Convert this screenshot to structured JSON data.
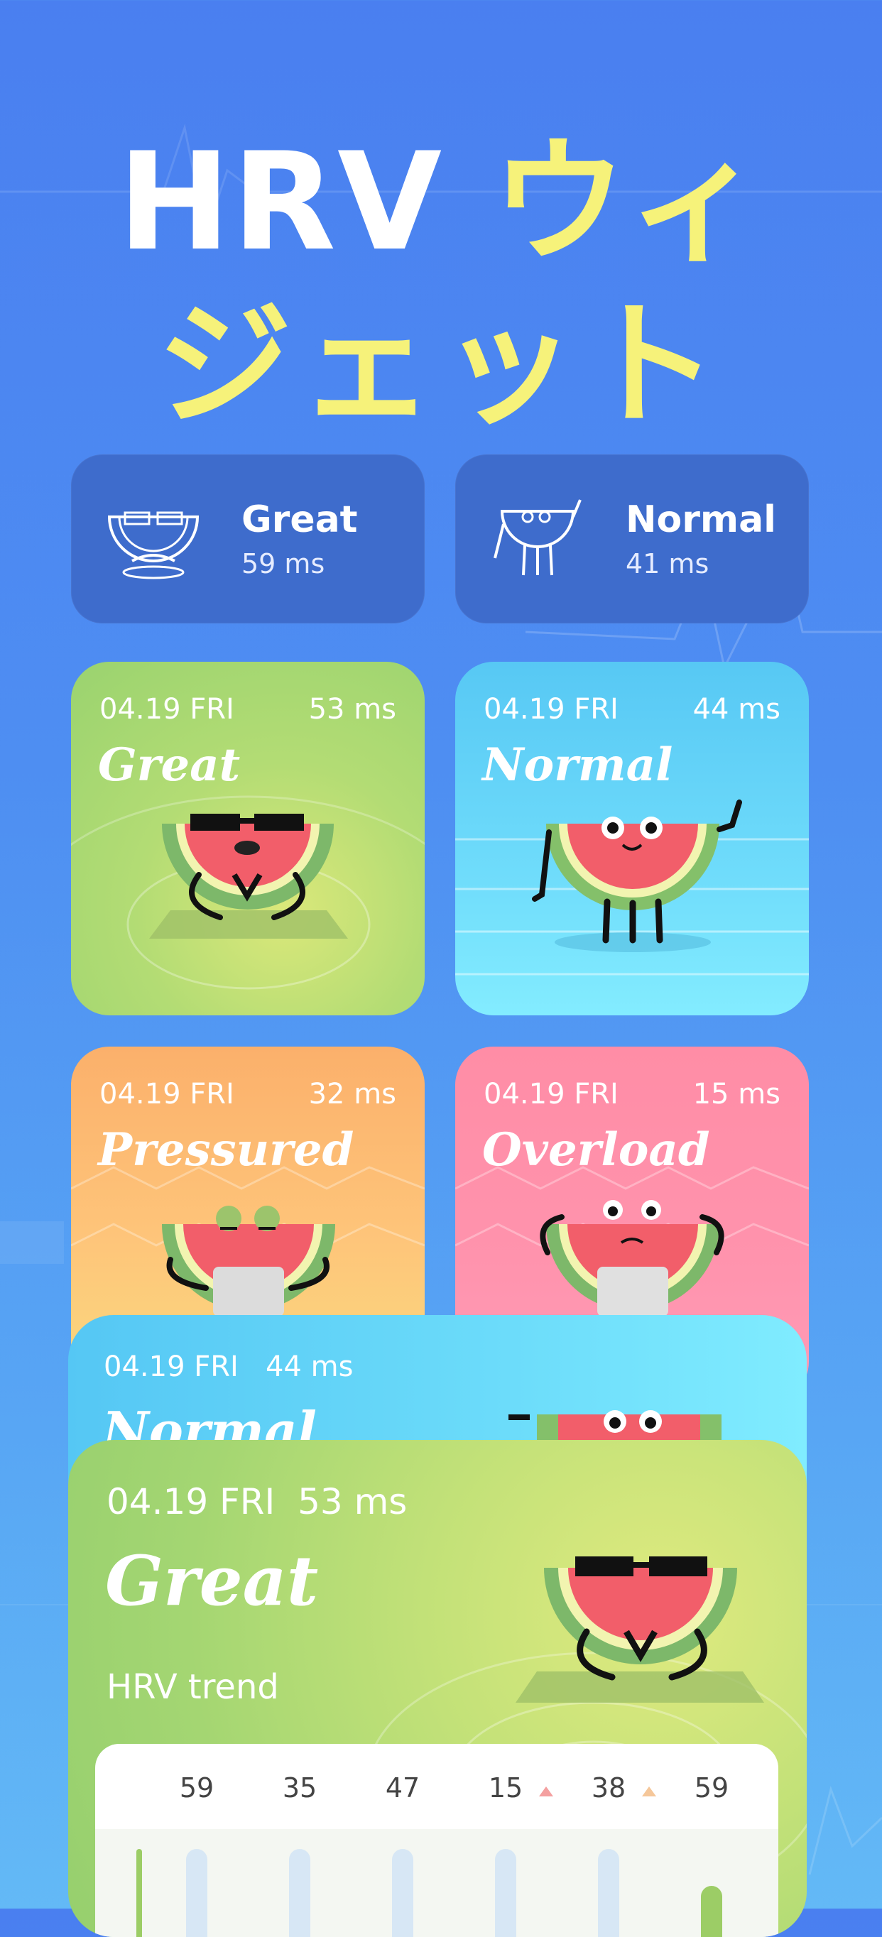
{
  "title": {
    "line1_white": "HRV ",
    "line1_yellow": "ウィ",
    "line2": "ジェット"
  },
  "small_widgets": [
    {
      "status": "Great",
      "value": "59 ms",
      "icon": "sunglasses-watermelon-icon"
    },
    {
      "status": "Normal",
      "value": "41 ms",
      "icon": "waving-watermelon-icon"
    }
  ],
  "tiles": [
    {
      "date": "04.19 FRI",
      "value": "53 ms",
      "status": "Great"
    },
    {
      "date": "04.19 FRI",
      "value": "44 ms",
      "status": "Normal"
    },
    {
      "date": "04.19 FRI",
      "value": "32 ms",
      "status": "Pressured"
    },
    {
      "date": "04.19 FRI",
      "value": "15 ms",
      "status": "Overload"
    }
  ],
  "big_normal": {
    "date": "04.19 FRI",
    "value": "44 ms",
    "status": "Normal"
  },
  "big_great": {
    "date": "04.19 FRI",
    "value": "53 ms",
    "status": "Great",
    "trend_label": "HRV trend"
  },
  "trend": {
    "values": [
      "59",
      "35",
      "47",
      "15",
      "38",
      "59"
    ],
    "arrows": [
      "",
      "",
      "",
      "up-red",
      "up-orange",
      ""
    ]
  },
  "colors": {
    "accent_yellow": "#f6f27a",
    "great": "#a4d672",
    "normal": "#6cdcfa",
    "pressured": "#fec57a",
    "overload": "#ff93ad"
  }
}
